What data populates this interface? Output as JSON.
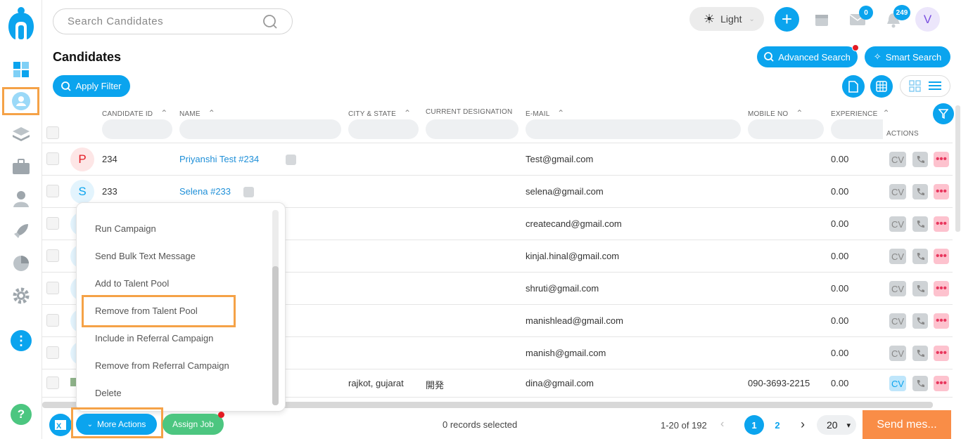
{
  "search": {
    "placeholder": "Search Candidates"
  },
  "theme": {
    "label": "Light"
  },
  "badges": {
    "mail": "0",
    "notifications": "249"
  },
  "user": {
    "initial": "V"
  },
  "page": {
    "title": "Candidates"
  },
  "buttons": {
    "advanced_search": "Advanced Search",
    "smart_search": "Smart Search",
    "apply_filter": "Apply Filter",
    "more_actions": "More Actions",
    "assign_job": "Assign Job",
    "send": "Send mes..."
  },
  "table": {
    "headers": [
      "CANDIDATE ID",
      "NAME",
      "CITY & STATE",
      "CURRENT DESIGNATION",
      "E-MAIL",
      "MOBILE NO",
      "EXPERIENCE",
      "ACTIONS"
    ],
    "rows": [
      {
        "initial": "P",
        "id": "234",
        "name": "Priyanshi Test #234",
        "city": "",
        "designation": "",
        "email": "Test@gmail.com",
        "mobile": "",
        "experience": "0.00"
      },
      {
        "initial": "S",
        "id": "233",
        "name": "Selena #233",
        "city": "",
        "designation": "",
        "email": "selena@gmail.com",
        "mobile": "",
        "experience": "0.00"
      },
      {
        "email": "createcand@gmail.com",
        "experience": "0.00"
      },
      {
        "email": "kinjal.hinal@gmail.com",
        "experience": "0.00"
      },
      {
        "email": "shruti@gmail.com",
        "experience": "0.00"
      },
      {
        "email": "manishlead@gmail.com",
        "experience": "0.00"
      },
      {
        "email": "manish@gmail.com",
        "experience": "0.00"
      },
      {
        "city": "rajkot, gujarat",
        "designation": "開発",
        "email": "dina@gmail.com",
        "mobile": "090-3693-2215",
        "experience": "0.00"
      }
    ],
    "cv_label": "CV"
  },
  "menu": {
    "items": [
      "Run Campaign",
      "Send Bulk Text Message",
      "Add to Talent Pool",
      "Remove from Talent Pool",
      "Include in Referral Campaign",
      "Remove from Referral Campaign",
      "Delete"
    ]
  },
  "footer": {
    "selected": "0 records selected",
    "range": "1-20 of 192",
    "pages": [
      "1",
      "2"
    ],
    "page_size": "20"
  },
  "colors": {
    "accent": "#0ba4ee",
    "highlight": "#f5a247",
    "send": "#f98d47",
    "green": "#4cc680"
  }
}
